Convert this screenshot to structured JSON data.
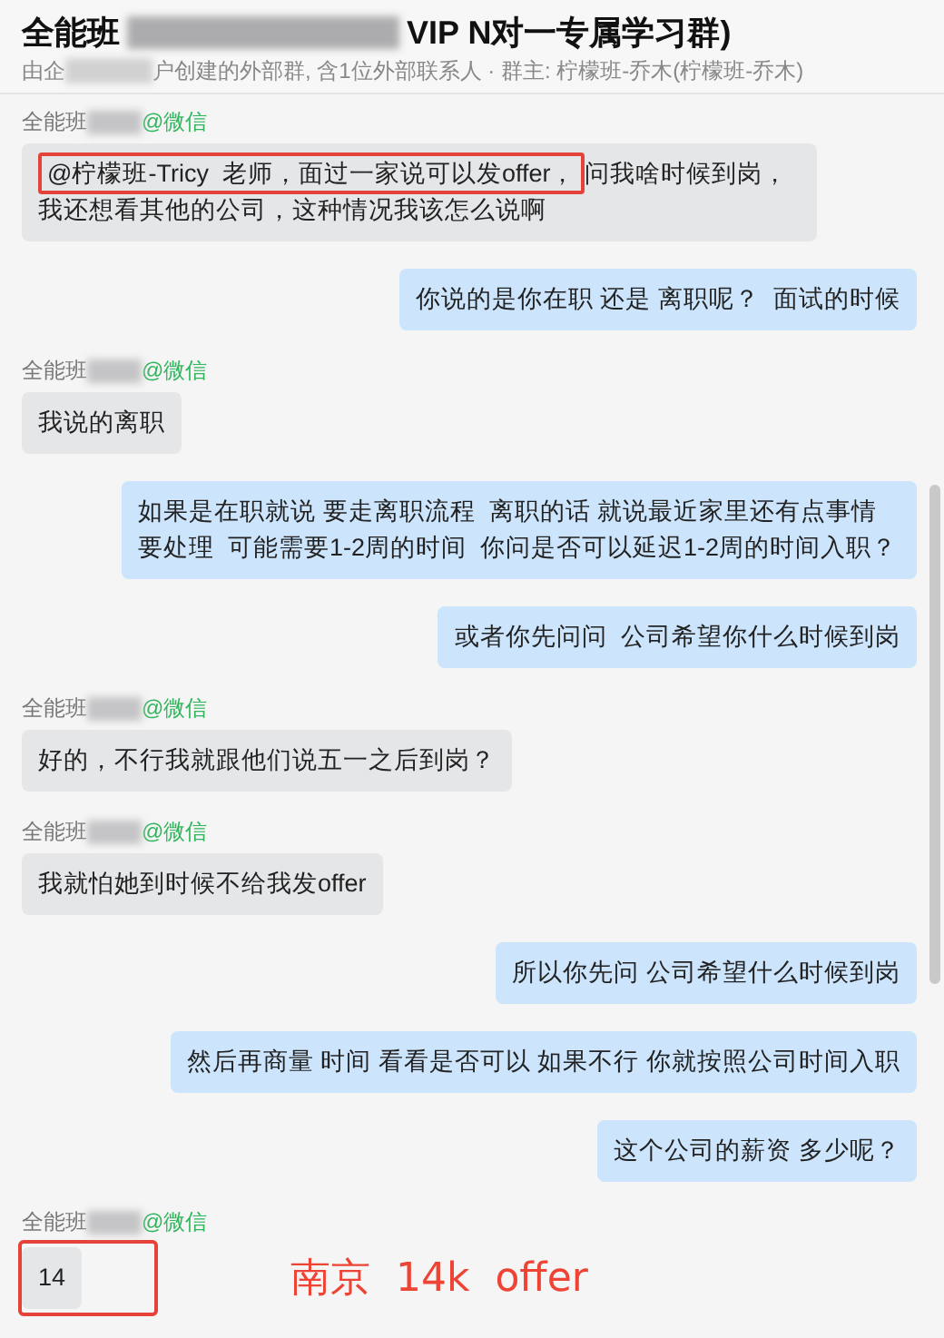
{
  "header": {
    "title_start": "全能班",
    "title_end": "VIP N对一专属学习群)",
    "subtitle_start": "由企",
    "subtitle_end": "户创建的外部群, 含1位外部联系人 · 群主: 柠檬班-乔木(柠檬班-乔木)"
  },
  "messages": [
    {
      "kind": "incoming",
      "sender": "全能班",
      "source": "@微信",
      "parts": [
        {
          "text": "@柠檬班-Tricy  老师，面过一家说可以发offer，",
          "boxed": true
        },
        {
          "text": "问我啥时候到岗，",
          "boxed": false
        },
        {
          "text": "我还想看其他的公司，这种情况我该怎么说啊",
          "boxed": false
        }
      ],
      "boxed": false
    },
    {
      "kind": "outgoing",
      "parts": [
        {
          "text": "你说的是你在职 还是 离职呢？  面试的时候",
          "boxed": false
        }
      ],
      "boxed": false
    },
    {
      "kind": "incoming",
      "sender": "全能班",
      "source": "@微信",
      "parts": [
        {
          "text": "我说的离职",
          "boxed": false
        }
      ],
      "boxed": false
    },
    {
      "kind": "outgoing",
      "parts": [
        {
          "text": "如果是在职就说 要走离职流程  离职的话 就说最近家里还有点事情要处理  可能需要1-2周的时间  你问是否可以延迟1-2周的时间入职？",
          "boxed": false
        }
      ],
      "boxed": false
    },
    {
      "kind": "outgoing",
      "parts": [
        {
          "text": "或者你先问问  公司希望你什么时候到岗",
          "boxed": false
        }
      ],
      "boxed": false
    },
    {
      "kind": "incoming",
      "sender": "全能班",
      "source": "@微信",
      "parts": [
        {
          "text": "好的，不行我就跟他们说五一之后到岗？",
          "boxed": false
        }
      ],
      "boxed": false
    },
    {
      "kind": "incoming",
      "sender": "全能班",
      "source": "@微信",
      "parts": [
        {
          "text": "我就怕她到时候不给我发offer",
          "boxed": false
        }
      ],
      "boxed": false
    },
    {
      "kind": "outgoing",
      "parts": [
        {
          "text": "所以你先问 公司希望什么时候到岗",
          "boxed": false
        }
      ],
      "boxed": false
    },
    {
      "kind": "outgoing",
      "parts": [
        {
          "text": "然后再商量 时间 看看是否可以 如果不行 你就按照公司时间入职",
          "boxed": false
        }
      ],
      "boxed": false
    },
    {
      "kind": "outgoing",
      "parts": [
        {
          "text": "这个公司的薪资 多少呢？",
          "boxed": false
        }
      ],
      "boxed": false
    },
    {
      "kind": "incoming",
      "sender": "全能班",
      "source": "@微信",
      "parts": [
        {
          "text": "14",
          "boxed": false
        }
      ],
      "boxed": true
    }
  ],
  "annotation": "南京  14k  offer"
}
